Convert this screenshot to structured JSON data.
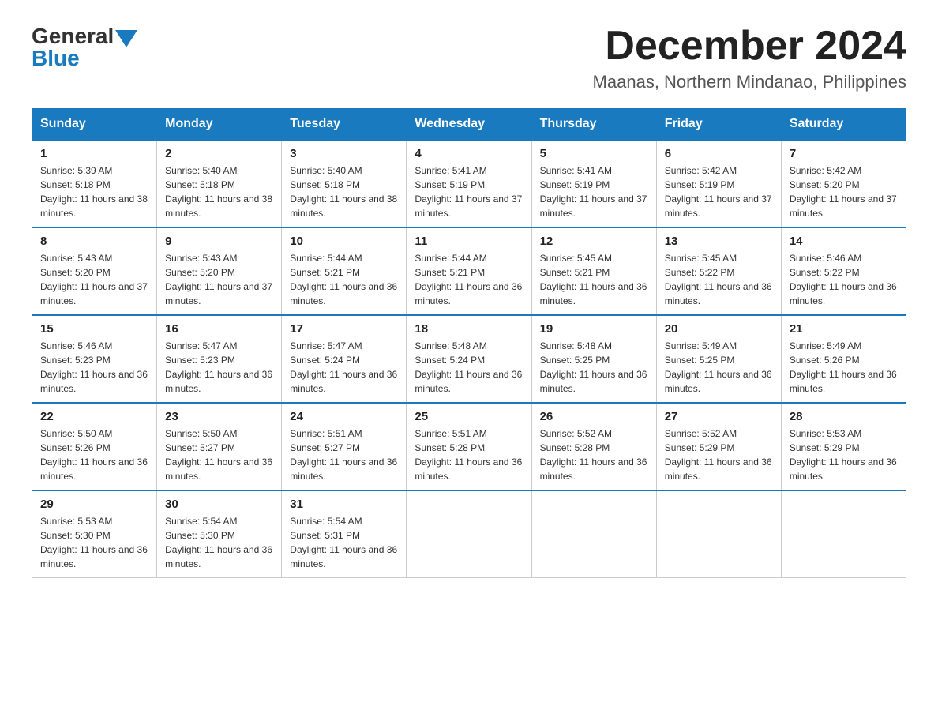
{
  "header": {
    "logo_general": "General",
    "logo_blue": "Blue",
    "month_title": "December 2024",
    "location": "Maanas, Northern Mindanao, Philippines"
  },
  "days_of_week": [
    "Sunday",
    "Monday",
    "Tuesday",
    "Wednesday",
    "Thursday",
    "Friday",
    "Saturday"
  ],
  "weeks": [
    [
      {
        "day": "1",
        "sunrise": "5:39 AM",
        "sunset": "5:18 PM",
        "daylight": "11 hours and 38 minutes."
      },
      {
        "day": "2",
        "sunrise": "5:40 AM",
        "sunset": "5:18 PM",
        "daylight": "11 hours and 38 minutes."
      },
      {
        "day": "3",
        "sunrise": "5:40 AM",
        "sunset": "5:18 PM",
        "daylight": "11 hours and 38 minutes."
      },
      {
        "day": "4",
        "sunrise": "5:41 AM",
        "sunset": "5:19 PM",
        "daylight": "11 hours and 37 minutes."
      },
      {
        "day": "5",
        "sunrise": "5:41 AM",
        "sunset": "5:19 PM",
        "daylight": "11 hours and 37 minutes."
      },
      {
        "day": "6",
        "sunrise": "5:42 AM",
        "sunset": "5:19 PM",
        "daylight": "11 hours and 37 minutes."
      },
      {
        "day": "7",
        "sunrise": "5:42 AM",
        "sunset": "5:20 PM",
        "daylight": "11 hours and 37 minutes."
      }
    ],
    [
      {
        "day": "8",
        "sunrise": "5:43 AM",
        "sunset": "5:20 PM",
        "daylight": "11 hours and 37 minutes."
      },
      {
        "day": "9",
        "sunrise": "5:43 AM",
        "sunset": "5:20 PM",
        "daylight": "11 hours and 37 minutes."
      },
      {
        "day": "10",
        "sunrise": "5:44 AM",
        "sunset": "5:21 PM",
        "daylight": "11 hours and 36 minutes."
      },
      {
        "day": "11",
        "sunrise": "5:44 AM",
        "sunset": "5:21 PM",
        "daylight": "11 hours and 36 minutes."
      },
      {
        "day": "12",
        "sunrise": "5:45 AM",
        "sunset": "5:21 PM",
        "daylight": "11 hours and 36 minutes."
      },
      {
        "day": "13",
        "sunrise": "5:45 AM",
        "sunset": "5:22 PM",
        "daylight": "11 hours and 36 minutes."
      },
      {
        "day": "14",
        "sunrise": "5:46 AM",
        "sunset": "5:22 PM",
        "daylight": "11 hours and 36 minutes."
      }
    ],
    [
      {
        "day": "15",
        "sunrise": "5:46 AM",
        "sunset": "5:23 PM",
        "daylight": "11 hours and 36 minutes."
      },
      {
        "day": "16",
        "sunrise": "5:47 AM",
        "sunset": "5:23 PM",
        "daylight": "11 hours and 36 minutes."
      },
      {
        "day": "17",
        "sunrise": "5:47 AM",
        "sunset": "5:24 PM",
        "daylight": "11 hours and 36 minutes."
      },
      {
        "day": "18",
        "sunrise": "5:48 AM",
        "sunset": "5:24 PM",
        "daylight": "11 hours and 36 minutes."
      },
      {
        "day": "19",
        "sunrise": "5:48 AM",
        "sunset": "5:25 PM",
        "daylight": "11 hours and 36 minutes."
      },
      {
        "day": "20",
        "sunrise": "5:49 AM",
        "sunset": "5:25 PM",
        "daylight": "11 hours and 36 minutes."
      },
      {
        "day": "21",
        "sunrise": "5:49 AM",
        "sunset": "5:26 PM",
        "daylight": "11 hours and 36 minutes."
      }
    ],
    [
      {
        "day": "22",
        "sunrise": "5:50 AM",
        "sunset": "5:26 PM",
        "daylight": "11 hours and 36 minutes."
      },
      {
        "day": "23",
        "sunrise": "5:50 AM",
        "sunset": "5:27 PM",
        "daylight": "11 hours and 36 minutes."
      },
      {
        "day": "24",
        "sunrise": "5:51 AM",
        "sunset": "5:27 PM",
        "daylight": "11 hours and 36 minutes."
      },
      {
        "day": "25",
        "sunrise": "5:51 AM",
        "sunset": "5:28 PM",
        "daylight": "11 hours and 36 minutes."
      },
      {
        "day": "26",
        "sunrise": "5:52 AM",
        "sunset": "5:28 PM",
        "daylight": "11 hours and 36 minutes."
      },
      {
        "day": "27",
        "sunrise": "5:52 AM",
        "sunset": "5:29 PM",
        "daylight": "11 hours and 36 minutes."
      },
      {
        "day": "28",
        "sunrise": "5:53 AM",
        "sunset": "5:29 PM",
        "daylight": "11 hours and 36 minutes."
      }
    ],
    [
      {
        "day": "29",
        "sunrise": "5:53 AM",
        "sunset": "5:30 PM",
        "daylight": "11 hours and 36 minutes."
      },
      {
        "day": "30",
        "sunrise": "5:54 AM",
        "sunset": "5:30 PM",
        "daylight": "11 hours and 36 minutes."
      },
      {
        "day": "31",
        "sunrise": "5:54 AM",
        "sunset": "5:31 PM",
        "daylight": "11 hours and 36 minutes."
      },
      null,
      null,
      null,
      null
    ]
  ],
  "labels": {
    "sunrise_prefix": "Sunrise: ",
    "sunset_prefix": "Sunset: ",
    "daylight_prefix": "Daylight: "
  }
}
